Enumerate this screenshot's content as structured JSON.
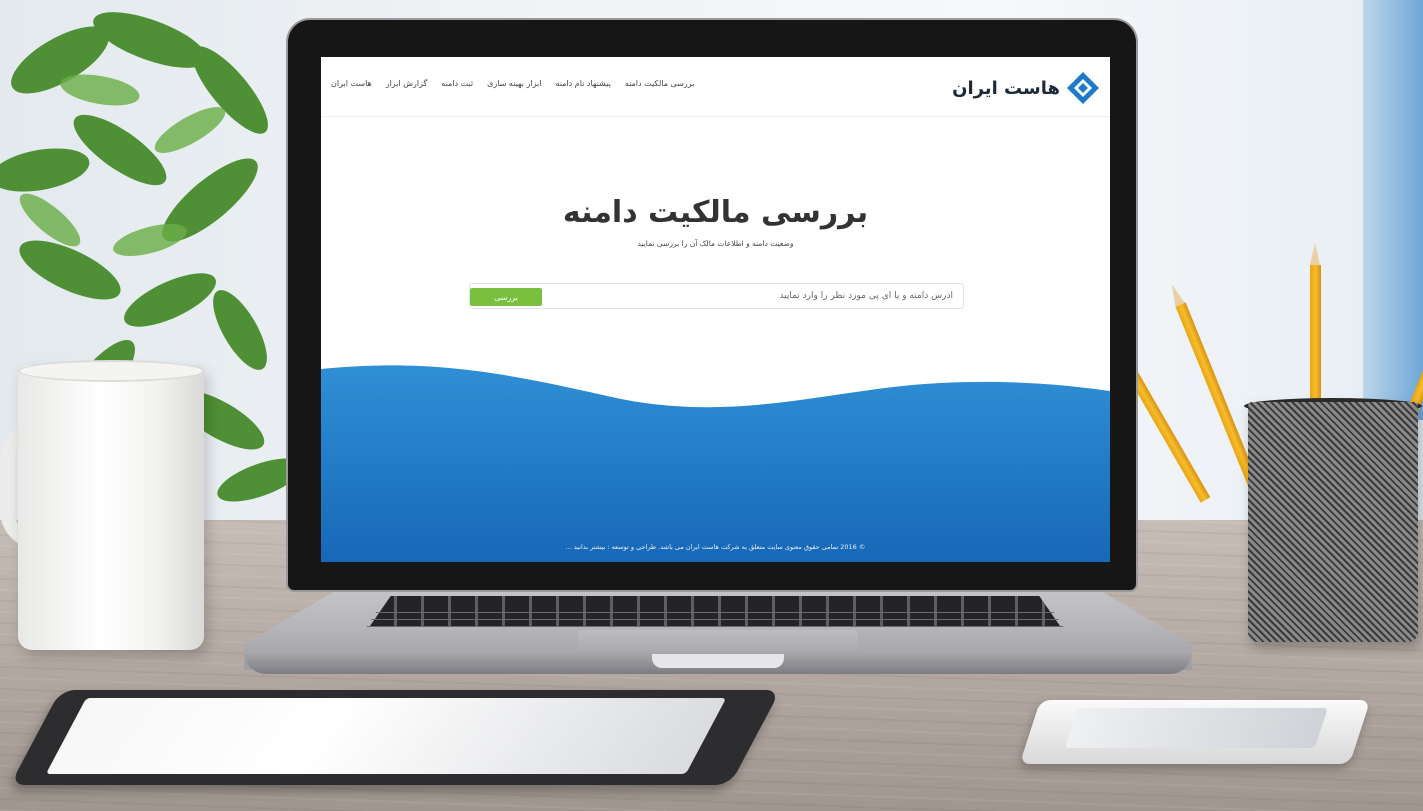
{
  "site": {
    "logo_text": "هاست ایران",
    "nav": [
      "بررسی مالکیت دامنه",
      "پیشنهاد نام دامنه",
      "ابزار بهینه سازی",
      "ثبت دامنه",
      "گزارش ابزار",
      "هاست ایران"
    ],
    "hero_title": "بررسی مالکیت دامنه",
    "hero_subtitle": "وضعیت دامنه و اطلاعات مالک آن را بررسی نمایید",
    "search_placeholder": "آدرس دامنه و یا آی پی مورد نظر را وارد نمایید",
    "search_button": "بررسی",
    "footer": "© 2016 تمامی حقوق معنوی سایت متعلق به شرکت هاست ایران می باشد. طراحی و توسعه : بیشتر بدانید ..."
  },
  "colors": {
    "accent_green": "#7bbf3f",
    "wave_blue": "#1f7fcc",
    "logo_blue": "#1e79c9"
  }
}
